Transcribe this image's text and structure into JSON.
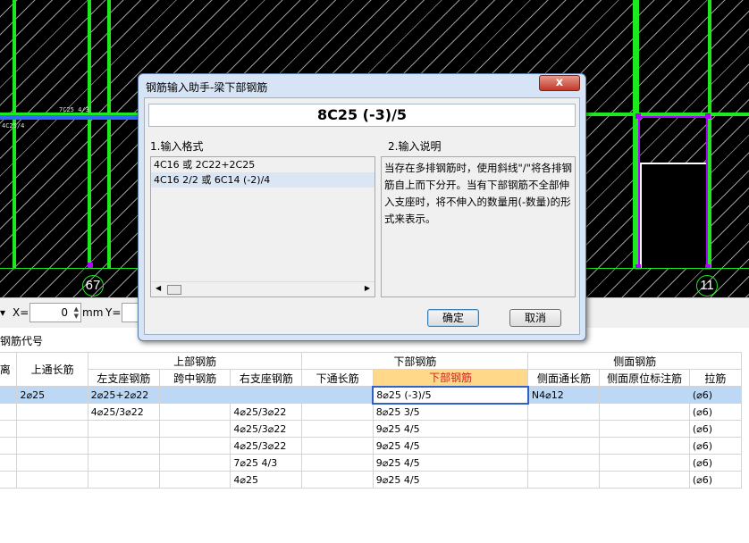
{
  "cad": {
    "axis_left": "67",
    "axis_right": "11",
    "beam_label_1": "7C25 4/3",
    "beam_label_2": "4C25/4"
  },
  "toolbar": {
    "x_label": "X=",
    "x_value": "0",
    "unit": "mm",
    "y_label": "Y="
  },
  "code_label": "钢筋代号",
  "dialog": {
    "title": "钢筋输入助手-梁下部钢筋",
    "close": "x",
    "input_value": "8C25 (-3)/5",
    "section1": "1.输入格式",
    "section2": "2.输入说明",
    "formats": [
      "4C16 或 2C22+2C25",
      "4C16 2/2 或 6C14 (-2)/4"
    ],
    "description": "当存在多排钢筋时，使用斜线\"/\"将各排钢筋自上而下分开。当有下部钢筋不全部伸入支座时，将不伸入的数量用(-数量)的形式来表示。",
    "ok": "确定",
    "cancel": "取消"
  },
  "grid": {
    "group_headers": [
      "上部钢筋",
      "下部钢筋",
      "侧面钢筋"
    ],
    "col_distance": "离",
    "col_top_through": "上通长筋",
    "cols_top": [
      "左支座钢筋",
      "跨中钢筋",
      "右支座钢筋"
    ],
    "cols_bottom": [
      "下通长筋",
      "下部钢筋"
    ],
    "cols_side": [
      "侧面通长筋",
      "侧面原位标注筋"
    ],
    "col_tie": "拉筋",
    "rows": [
      [
        "",
        "2⌀25",
        "2⌀25+2⌀22",
        "",
        "",
        "",
        "8⌀25 (-3)/5",
        "N4⌀12",
        "",
        "(⌀6)"
      ],
      [
        "",
        "",
        "4⌀25/3⌀22",
        "",
        "4⌀25/3⌀22",
        "",
        "8⌀25 3/5",
        "",
        "",
        "(⌀6)"
      ],
      [
        "",
        "",
        "",
        "",
        "4⌀25/3⌀22",
        "",
        "9⌀25 4/5",
        "",
        "",
        "(⌀6)"
      ],
      [
        "",
        "",
        "",
        "",
        "4⌀25/3⌀22",
        "",
        "9⌀25 4/5",
        "",
        "",
        "(⌀6)"
      ],
      [
        "",
        "",
        "",
        "",
        "7⌀25 4/3",
        "",
        "9⌀25 4/5",
        "",
        "",
        "(⌀6)"
      ],
      [
        "",
        "",
        "",
        "",
        "4⌀25",
        "",
        "9⌀25 4/5",
        "",
        "",
        "(⌀6)"
      ]
    ]
  }
}
